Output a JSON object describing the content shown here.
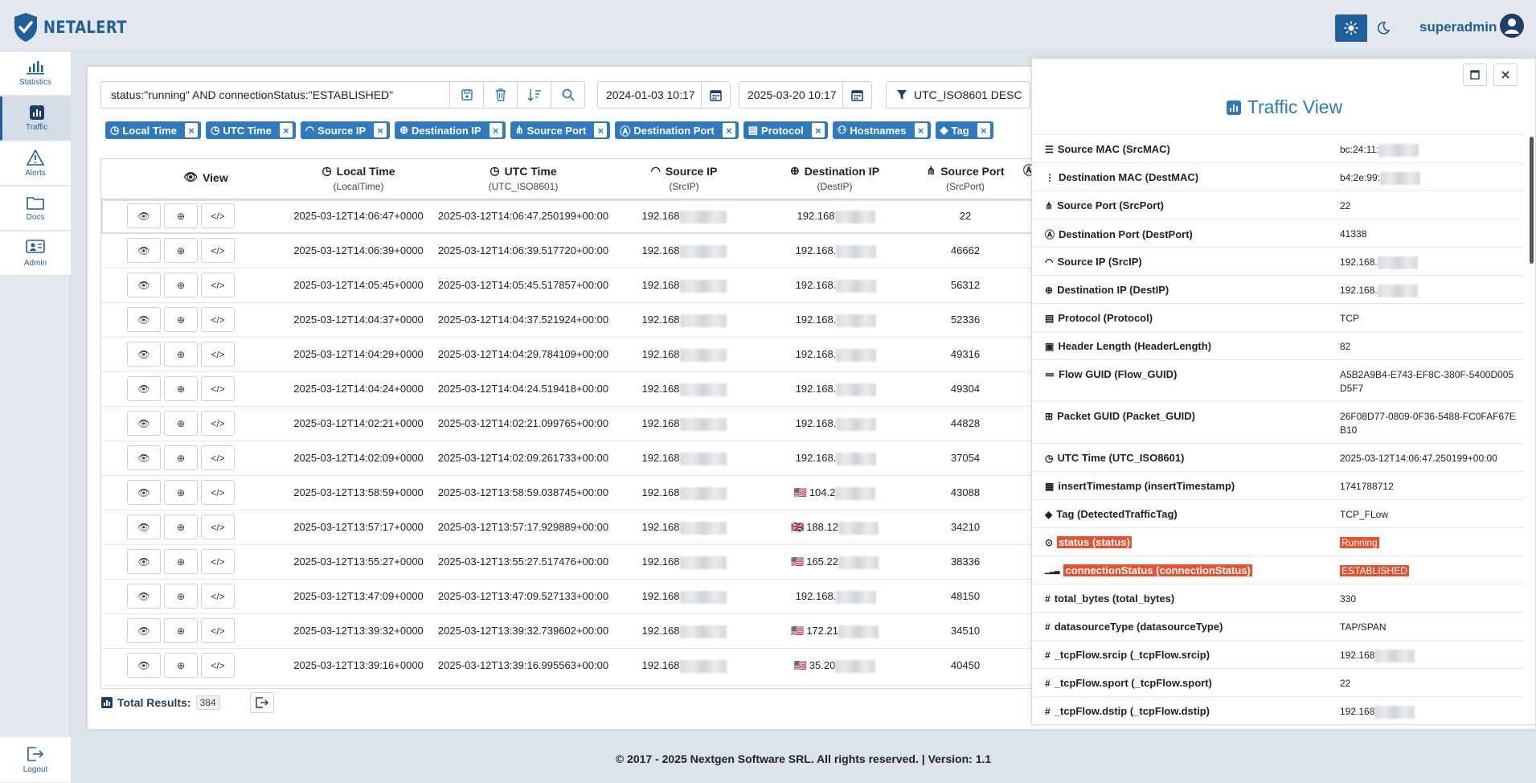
{
  "app": {
    "name": "NETALERT",
    "user": "superadmin"
  },
  "sidebar": [
    {
      "label": "Statistics",
      "icon": "bar-chart-icon"
    },
    {
      "label": "Traffic",
      "icon": "chart-square-icon",
      "active": true
    },
    {
      "label": "Alerts",
      "icon": "warning-icon"
    },
    {
      "label": "Docs",
      "icon": "folder-icon"
    },
    {
      "label": "Admin",
      "icon": "admin-icon"
    }
  ],
  "logout_label": "Logout",
  "search": {
    "query": "status:\"running\" AND connectionStatus:\"ESTABLISHED\""
  },
  "date_from": "2024-01-03 10:17",
  "date_to": "2025-03-20 10:17",
  "sort": "UTC_ISO8601 DESC",
  "chips": [
    "Local Time",
    "UTC Time",
    "Source IP",
    "Destination IP",
    "Source Port",
    "Destination Port",
    "Protocol",
    "Hostnames",
    "Tag"
  ],
  "columns": [
    {
      "title": "View",
      "sub": ""
    },
    {
      "title": "Local Time",
      "sub": "(LocalTime)"
    },
    {
      "title": "UTC Time",
      "sub": "(UTC_ISO8601)"
    },
    {
      "title": "Source IP",
      "sub": "(SrcIP)"
    },
    {
      "title": "Destination IP",
      "sub": "(DestIP)"
    },
    {
      "title": "Source Port",
      "sub": "(SrcPort)"
    }
  ],
  "rows": [
    {
      "local": "2025-03-12T14:06:47+0000",
      "utc": "2025-03-12T14:06:47.250199+00:00",
      "src": "192.168",
      "dst": "192.168",
      "flag": "",
      "port": "22"
    },
    {
      "local": "2025-03-12T14:06:39+0000",
      "utc": "2025-03-12T14:06:39.517720+00:00",
      "src": "192.168",
      "dst": "192.168.",
      "flag": "",
      "port": "46662"
    },
    {
      "local": "2025-03-12T14:05:45+0000",
      "utc": "2025-03-12T14:05:45.517857+00:00",
      "src": "192.168",
      "dst": "192.168.",
      "flag": "",
      "port": "56312"
    },
    {
      "local": "2025-03-12T14:04:37+0000",
      "utc": "2025-03-12T14:04:37.521924+00:00",
      "src": "192.168",
      "dst": "192.168.",
      "flag": "",
      "port": "52336"
    },
    {
      "local": "2025-03-12T14:04:29+0000",
      "utc": "2025-03-12T14:04:29.784109+00:00",
      "src": "192.168",
      "dst": "192.168.",
      "flag": "",
      "port": "49316"
    },
    {
      "local": "2025-03-12T14:04:24+0000",
      "utc": "2025-03-12T14:04:24.519418+00:00",
      "src": "192.168",
      "dst": "192.168.",
      "flag": "",
      "port": "49304"
    },
    {
      "local": "2025-03-12T14:02:21+0000",
      "utc": "2025-03-12T14:02:21.099765+00:00",
      "src": "192.168",
      "dst": "192.168.",
      "flag": "",
      "port": "44828"
    },
    {
      "local": "2025-03-12T14:02:09+0000",
      "utc": "2025-03-12T14:02:09.261733+00:00",
      "src": "192.168",
      "dst": "192.168.",
      "flag": "",
      "port": "37054"
    },
    {
      "local": "2025-03-12T13:58:59+0000",
      "utc": "2025-03-12T13:58:59.038745+00:00",
      "src": "192.168",
      "dst": "104.2",
      "flag": "🇺🇸",
      "port": "43088"
    },
    {
      "local": "2025-03-12T13:57:17+0000",
      "utc": "2025-03-12T13:57:17.929889+00:00",
      "src": "192.168",
      "dst": "188.12",
      "flag": "🇬🇧",
      "port": "34210"
    },
    {
      "local": "2025-03-12T13:55:27+0000",
      "utc": "2025-03-12T13:55:27.517476+00:00",
      "src": "192.168",
      "dst": "165.22",
      "flag": "🇺🇸",
      "port": "38336"
    },
    {
      "local": "2025-03-12T13:47:09+0000",
      "utc": "2025-03-12T13:47:09.527133+00:00",
      "src": "192.168",
      "dst": "192.168.",
      "flag": "",
      "port": "48150"
    },
    {
      "local": "2025-03-12T13:39:32+0000",
      "utc": "2025-03-12T13:39:32.739602+00:00",
      "src": "192.168",
      "dst": "172.21",
      "flag": "🇺🇸",
      "port": "34510"
    },
    {
      "local": "2025-03-12T13:39:16+0000",
      "utc": "2025-03-12T13:39:16.995563+00:00",
      "src": "192.168",
      "dst": "35.20",
      "flag": "🇺🇸",
      "port": "40450"
    }
  ],
  "total": {
    "label": "Total Results:",
    "count": "384"
  },
  "panel": {
    "title": "Traffic View",
    "fields": [
      {
        "key": "Source MAC (SrcMAC)",
        "value": "bc:24:11:",
        "blur": true,
        "icon": "database-icon"
      },
      {
        "key": "Destination MAC (DestMAC)",
        "value": "b4:2e:99:",
        "blur": true,
        "icon": "network-icon"
      },
      {
        "key": "Source Port (SrcPort)",
        "value": "22",
        "icon": "share-icon"
      },
      {
        "key": "Destination Port (DestPort)",
        "value": "41338",
        "icon": "port-icon"
      },
      {
        "key": "Source IP (SrcIP)",
        "value": "192.168.",
        "blur": true,
        "icon": "wifi-icon"
      },
      {
        "key": "Destination IP (DestIP)",
        "value": "192.168.",
        "blur": true,
        "icon": "globe-icon"
      },
      {
        "key": "Protocol (Protocol)",
        "value": "TCP",
        "icon": "file-icon"
      },
      {
        "key": "Header Length (HeaderLength)",
        "value": "82",
        "icon": "header-icon"
      },
      {
        "key": "Flow GUID (Flow_GUID)",
        "value": "A5B2A9B4-E743-EF8C-380F-5400D005D5F7",
        "icon": "list-icon",
        "tall": true
      },
      {
        "key": "Packet GUID (Packet_GUID)",
        "value": "26F08D77-0809-0F36-5488-FC0FAF67EB10",
        "icon": "sitemap-icon",
        "tall": true
      },
      {
        "key": "UTC Time (UTC_ISO8601)",
        "value": "2025-03-12T14:06:47.250199+00:00",
        "icon": "clock-icon"
      },
      {
        "key": "insertTimestamp (insertTimestamp)",
        "value": "1741788712",
        "icon": "calendar-icon"
      },
      {
        "key": "Tag (DetectedTrafficTag)",
        "value": "TCP_FLow",
        "icon": "tag-icon"
      },
      {
        "key": "status (status)",
        "value": "Running",
        "icon": "status-icon",
        "highlight": true
      },
      {
        "key": "connectionStatus (connectionStatus)",
        "value": "ESTABLISHED",
        "icon": "signal-icon",
        "highlight": true
      },
      {
        "key": "total_bytes (total_bytes)",
        "value": "330",
        "icon": "hash-icon"
      },
      {
        "key": "datasourceType (datasourceType)",
        "value": "TAP/SPAN",
        "icon": "hash-icon"
      },
      {
        "key": "_tcpFlow.srcip (_tcpFlow.srcip)",
        "value": "192.168",
        "blur": true,
        "icon": "hash-icon"
      },
      {
        "key": "_tcpFlow.sport (_tcpFlow.sport)",
        "value": "22",
        "icon": "hash-icon"
      },
      {
        "key": "_tcpFlow.dstip (_tcpFlow.dstip)",
        "value": "192.168",
        "blur": true,
        "icon": "hash-icon"
      }
    ]
  },
  "footer": "© 2017 - 2025 Nextgen Software SRL. All rights reserved. | Version: 1.1",
  "colors": {
    "brand": "#1f5f9a",
    "chip": "#2f7abf",
    "highlight": "#e8512f"
  }
}
